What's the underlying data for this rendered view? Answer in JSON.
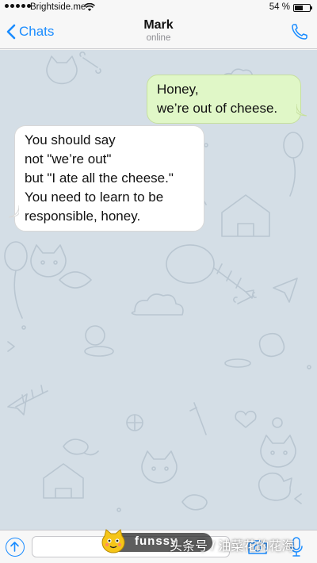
{
  "status_bar": {
    "carrier": "Brightside.me",
    "battery_text": "54 %",
    "battery_level": 0.54
  },
  "nav": {
    "back_label": "Chats",
    "title": "Mark",
    "subtitle": "online"
  },
  "messages": [
    {
      "direction": "outgoing",
      "lines": [
        "Honey,",
        "we’re out of cheese."
      ]
    },
    {
      "direction": "incoming",
      "lines": [
        "You should say",
        "not \"we’re out\"",
        "but \"I ate all the cheese.\"",
        "You need to learn to be",
        "responsible, honey."
      ]
    }
  ],
  "input": {
    "value": "",
    "placeholder": ""
  },
  "watermark": {
    "brand": "funssy",
    "text": "头条号 / 油菜花的花海"
  },
  "colors": {
    "accent": "#1a8cff",
    "chat_background": "#d4dee6",
    "outgoing_bubble": "#e0f7c7",
    "incoming_bubble": "#ffffff"
  },
  "icons": {
    "back": "chevron-left-icon",
    "call": "phone-icon",
    "attach": "arrow-up-circle-icon",
    "camera": "camera-icon",
    "mic": "microphone-icon"
  }
}
